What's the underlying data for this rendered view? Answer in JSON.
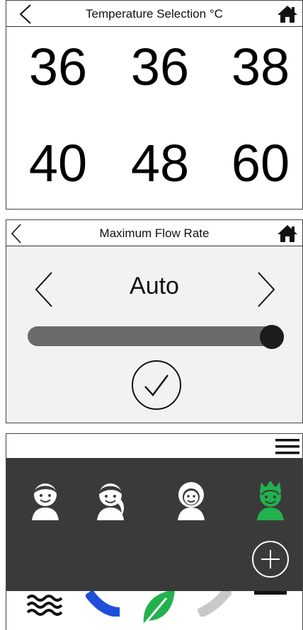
{
  "temperature_panel": {
    "title": "Temperature Selection °C",
    "values": [
      "36",
      "36",
      "38",
      "40",
      "48",
      "60"
    ]
  },
  "flow_panel": {
    "title": "Maximum Flow Rate",
    "value": "Auto",
    "slider_level": 1.0
  },
  "profiles_panel": {
    "users": [
      {
        "name": "boy-avatar-icon",
        "color": "#ffffff",
        "selected": false
      },
      {
        "name": "girl-avatar-icon",
        "color": "#ffffff",
        "selected": false
      },
      {
        "name": "curly-hair-avatar-icon",
        "color": "#ffffff",
        "selected": false
      },
      {
        "name": "spiky-hair-avatar-icon",
        "color": "#22b14c",
        "selected": true
      }
    ],
    "bottom_icons": [
      "water-waves-icon",
      "blue-stroke-icon",
      "eco-leaf-icon",
      "gray-stroke-icon",
      "black-bar-icon"
    ]
  },
  "colors": {
    "selected_user": "#22b14c",
    "overlay": "#3a3a3a",
    "slider_track": "#6b6b6b"
  }
}
